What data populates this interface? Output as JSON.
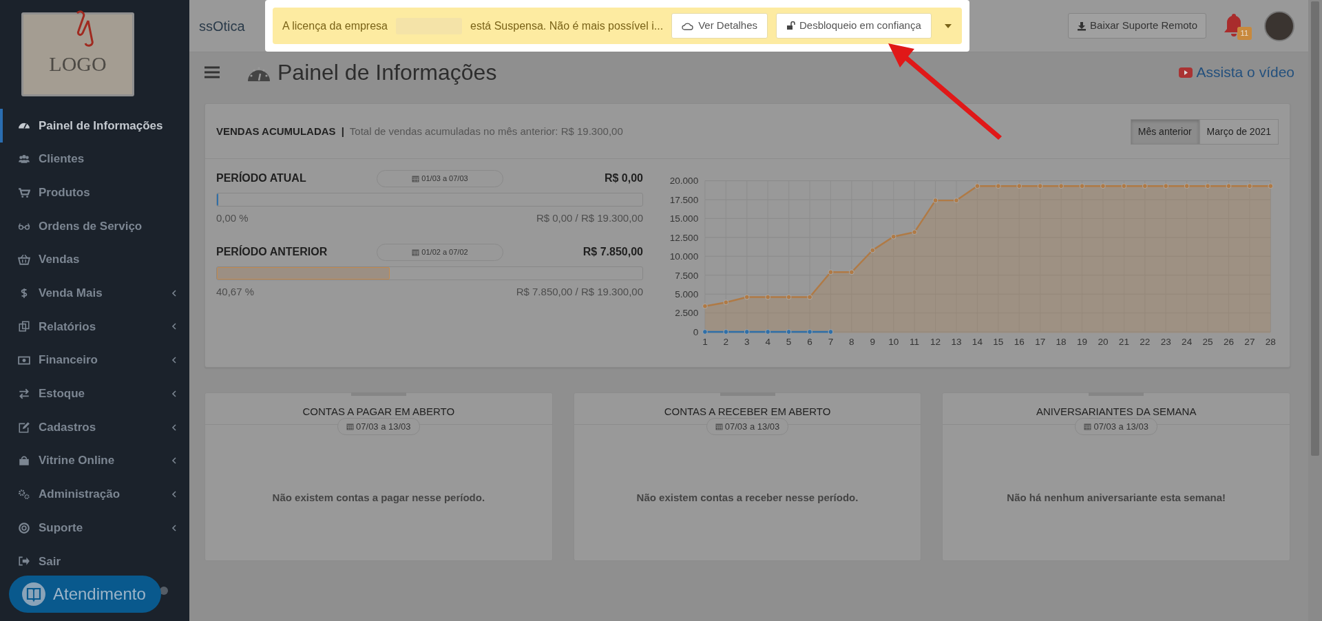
{
  "logo": {
    "text": "LOGO"
  },
  "sidebar": {
    "items": [
      {
        "label": "Painel de Informações",
        "selected": true,
        "expandable": false
      },
      {
        "label": "Clientes",
        "selected": false,
        "expandable": false
      },
      {
        "label": "Produtos",
        "selected": false,
        "expandable": false
      },
      {
        "label": "Ordens de Serviço",
        "selected": false,
        "expandable": false
      },
      {
        "label": "Vendas",
        "selected": false,
        "expandable": false
      },
      {
        "label": "Venda Mais",
        "selected": false,
        "expandable": true
      },
      {
        "label": "Relatórios",
        "selected": false,
        "expandable": true
      },
      {
        "label": "Financeiro",
        "selected": false,
        "expandable": true
      },
      {
        "label": "Estoque",
        "selected": false,
        "expandable": true
      },
      {
        "label": "Cadastros",
        "selected": false,
        "expandable": true
      },
      {
        "label": "Vitrine Online",
        "selected": false,
        "expandable": true
      },
      {
        "label": "Administração",
        "selected": false,
        "expandable": true
      },
      {
        "label": "Suporte",
        "selected": false,
        "expandable": true
      },
      {
        "label": "Sair",
        "selected": false,
        "expandable": false
      }
    ]
  },
  "chat_button": {
    "label": "Atendimento"
  },
  "header": {
    "brand": "ssOtica",
    "remote_support_button": "Baixar Suporte Remoto",
    "notification_count": "11"
  },
  "license_alert": {
    "message_before": "A licença da empresa",
    "message_after": "está Suspensa. Não é mais possível i...",
    "buttons": [
      "Ver Detalhes",
      "Desbloqueio em confiança"
    ]
  },
  "page": {
    "title": "Painel de Informações",
    "video_link": "Assista o vídeo"
  },
  "sales_card": {
    "title": "VENDAS ACUMULADAS",
    "separator": "|",
    "subtitle": "Total de vendas acumuladas no mês anterior:  R$ 19.300,00",
    "period_buttons": [
      {
        "label": "Mês anterior",
        "selected": true
      },
      {
        "label": "Março de 2021",
        "selected": false
      }
    ],
    "periods": [
      {
        "label": "PERÍODO ATUAL",
        "date": "01/03 a 07/03",
        "value": "R$ 0,00",
        "level": 0.0,
        "color": "#2f6fa8",
        "percent": "0,00 %",
        "ratio": "R$ 0,00 / R$ 19.300,00"
      },
      {
        "label": "PERÍODO ANTERIOR",
        "date": "01/02 a 07/02",
        "value": "R$ 7.850,00",
        "level": 0.4067,
        "color": "#c38a4e",
        "percent": "40,67 %",
        "ratio": "R$ 7.850,00 / R$ 19.300,00"
      }
    ],
    "chart_data": {
      "type": "area",
      "x": [
        1,
        2,
        3,
        4,
        5,
        6,
        7,
        8,
        9,
        10,
        11,
        12,
        13,
        14,
        15,
        16,
        17,
        18,
        19,
        20,
        21,
        22,
        23,
        24,
        25,
        26,
        27,
        28
      ],
      "xlim": [
        1,
        28
      ],
      "grid": true,
      "ylim": [
        0,
        20000
      ],
      "yticks": [
        {
          "value": 0,
          "label": "0"
        },
        {
          "value": 2500,
          "label": "2.500"
        },
        {
          "value": 5000,
          "label": "5.000"
        },
        {
          "value": 7500,
          "label": "7.500"
        },
        {
          "value": 10000,
          "label": "10.000"
        },
        {
          "value": 12500,
          "label": "12.500"
        },
        {
          "value": 15000,
          "label": "15.000"
        },
        {
          "value": 17500,
          "label": "17.500"
        },
        {
          "value": 20000,
          "label": "20.000"
        }
      ],
      "xticks": [
        1,
        2,
        3,
        4,
        5,
        6,
        7,
        8,
        9,
        10,
        11,
        12,
        13,
        14,
        15,
        16,
        17,
        18,
        19,
        20,
        21,
        22,
        23,
        24,
        25,
        26,
        27,
        28
      ],
      "series": [
        {
          "color": "#b07a45",
          "values": [
            3400,
            3900,
            4600,
            4600,
            4600,
            4600,
            7900,
            7900,
            10800,
            12600,
            13200,
            17400,
            17400,
            19300,
            19300,
            19300,
            19300,
            19300,
            19300,
            19300,
            19300,
            19300,
            19300,
            19300,
            19300,
            19300,
            19300,
            19300
          ]
        },
        {
          "color": "#2f6fa8",
          "values": [
            0,
            0,
            0,
            0,
            0,
            0,
            0,
            null,
            null,
            null,
            null,
            null,
            null,
            null,
            null,
            null,
            null,
            null,
            null,
            null,
            null,
            null,
            null,
            null,
            null,
            null,
            null,
            null
          ]
        }
      ]
    }
  },
  "summary_cards": [
    {
      "title": "CONTAS A PAGAR EM ABERTO",
      "date": "07/03 a 13/03",
      "message": "Não existem contas a pagar nesse período."
    },
    {
      "title": "CONTAS A RECEBER EM ABERTO",
      "date": "07/03 a 13/03",
      "message": "Não existem contas a receber nesse período."
    },
    {
      "title": "ANIVERSARIANTES DA SEMANA",
      "date": "07/03 a 13/03",
      "message": "Não há nenhum aniversariante esta semana!"
    }
  ]
}
